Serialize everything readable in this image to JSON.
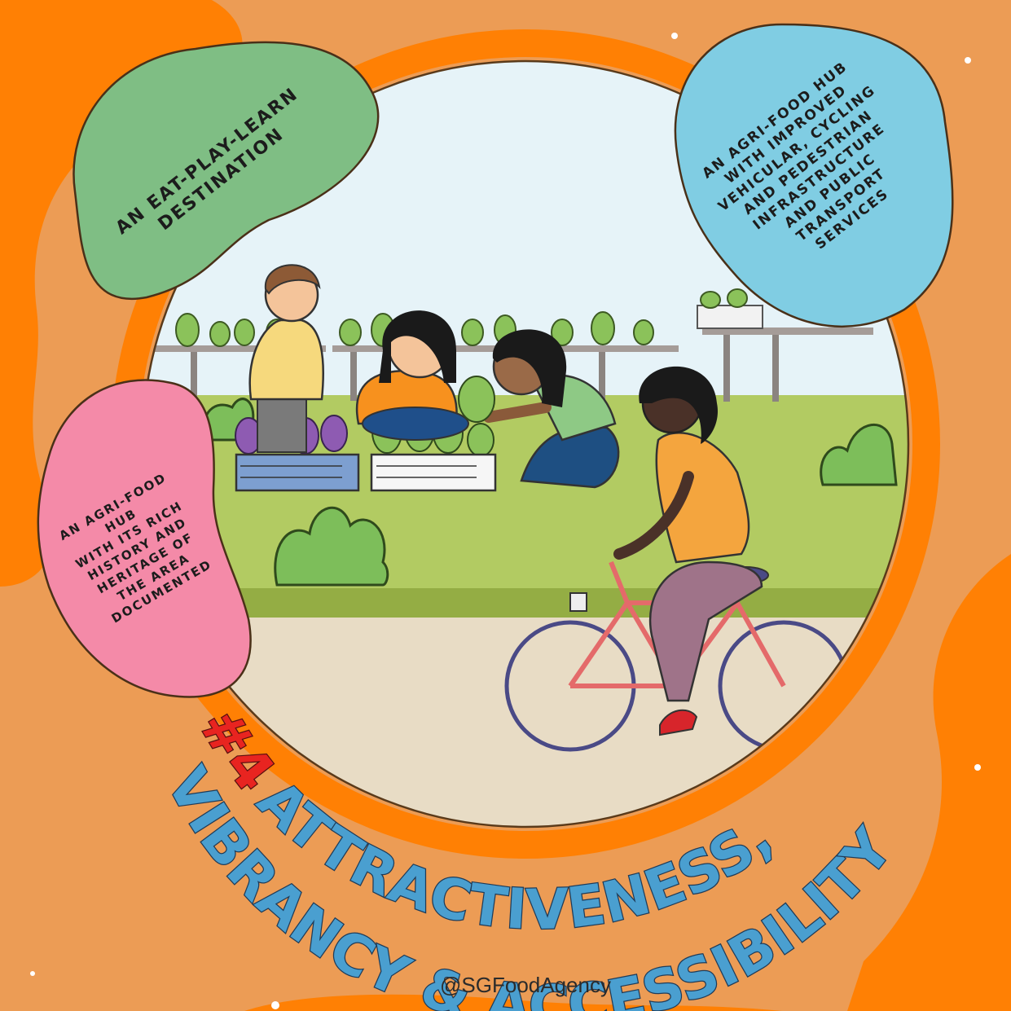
{
  "blob_green": {
    "lines": [
      "AN EAT-PLAY-LEARN",
      "DESTINATION"
    ]
  },
  "blob_blue": {
    "lines": [
      "AN AGRI-FOOD HUB",
      "WITH IMPROVED",
      "VEHICULAR, CYCLING",
      "AND PEDESTRIAN",
      "INFRASTRUCTURE",
      "AND PUBLIC",
      "TRANSPORT",
      "SERVICES"
    ]
  },
  "blob_pink": {
    "lines": [
      "AN AGRI-FOOD",
      "HUB",
      "WITH ITS RICH",
      "HISTORY AND",
      "HERITAGE OF",
      "THE AREA",
      "DOCUMENTED"
    ]
  },
  "title": {
    "number": "#4",
    "line1": "ATTRACTIVENESS,",
    "line2": "VIBRANCY & ACCESSIBILITY"
  },
  "handle": "@SGFoodAgency",
  "colors": {
    "background": "#ec9c55",
    "accent_orange": "#ff8004",
    "green_blob": "#7fbe84",
    "blue_blob": "#80cde3",
    "pink_blob": "#f48aa8",
    "title_blue": "#4a9fd0",
    "title_red": "#e82420"
  }
}
